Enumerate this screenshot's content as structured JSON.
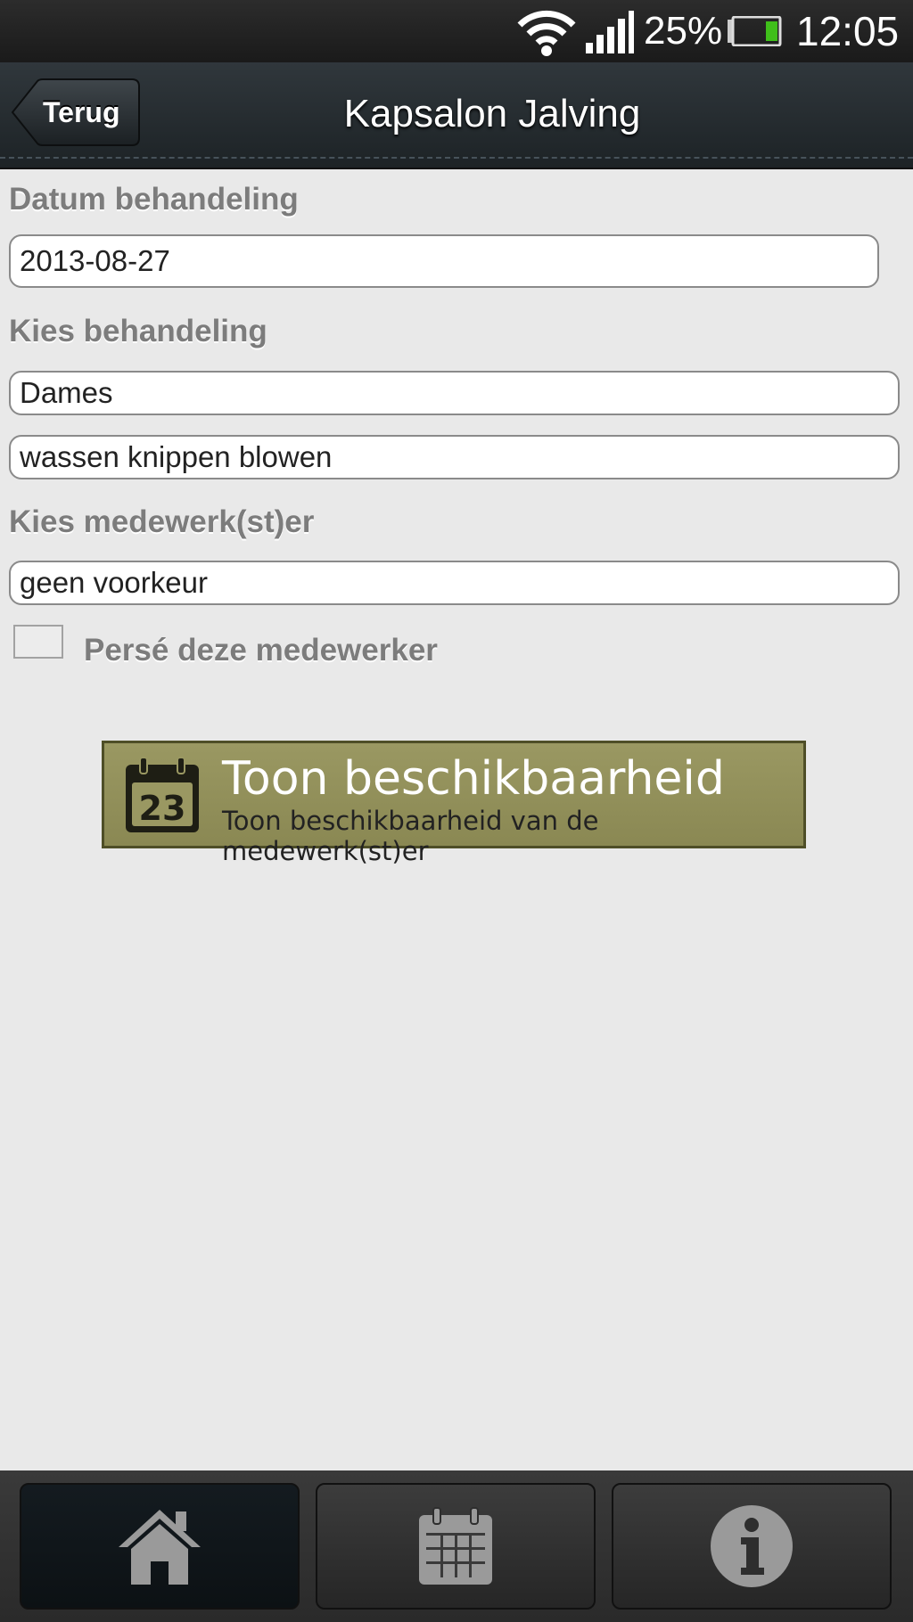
{
  "status_bar": {
    "battery_percent": "25%",
    "battery_level": 0.25,
    "time": "12:05",
    "icons": [
      "wifi-icon",
      "signal-icon",
      "battery-icon"
    ],
    "battery_color": "#3fbf1a"
  },
  "header": {
    "back_label": "Terug",
    "title": "Kapsalon Jalving"
  },
  "form": {
    "date_label": "Datum behandeling",
    "date_value": "2013-08-27",
    "treatment_label": "Kies behandeling",
    "treatment_category": "Dames",
    "treatment_type": "wassen knippen blowen",
    "employee_label": "Kies medewerk(st)er",
    "employee_value": "geen voorkeur",
    "checkbox_label": "Persé deze medewerker",
    "checkbox_checked": false
  },
  "availability_button": {
    "title": "Toon beschikbaarheid",
    "subtitle": "Toon beschikbaarheid van de medewerk(st)er",
    "icon": "calendar-icon",
    "icon_day": "23",
    "color": "#8f8d58"
  },
  "tabbar": {
    "tabs": [
      {
        "icon": "home-icon",
        "active": true
      },
      {
        "icon": "calendar-icon",
        "active": false
      },
      {
        "icon": "info-icon",
        "active": false
      }
    ]
  }
}
